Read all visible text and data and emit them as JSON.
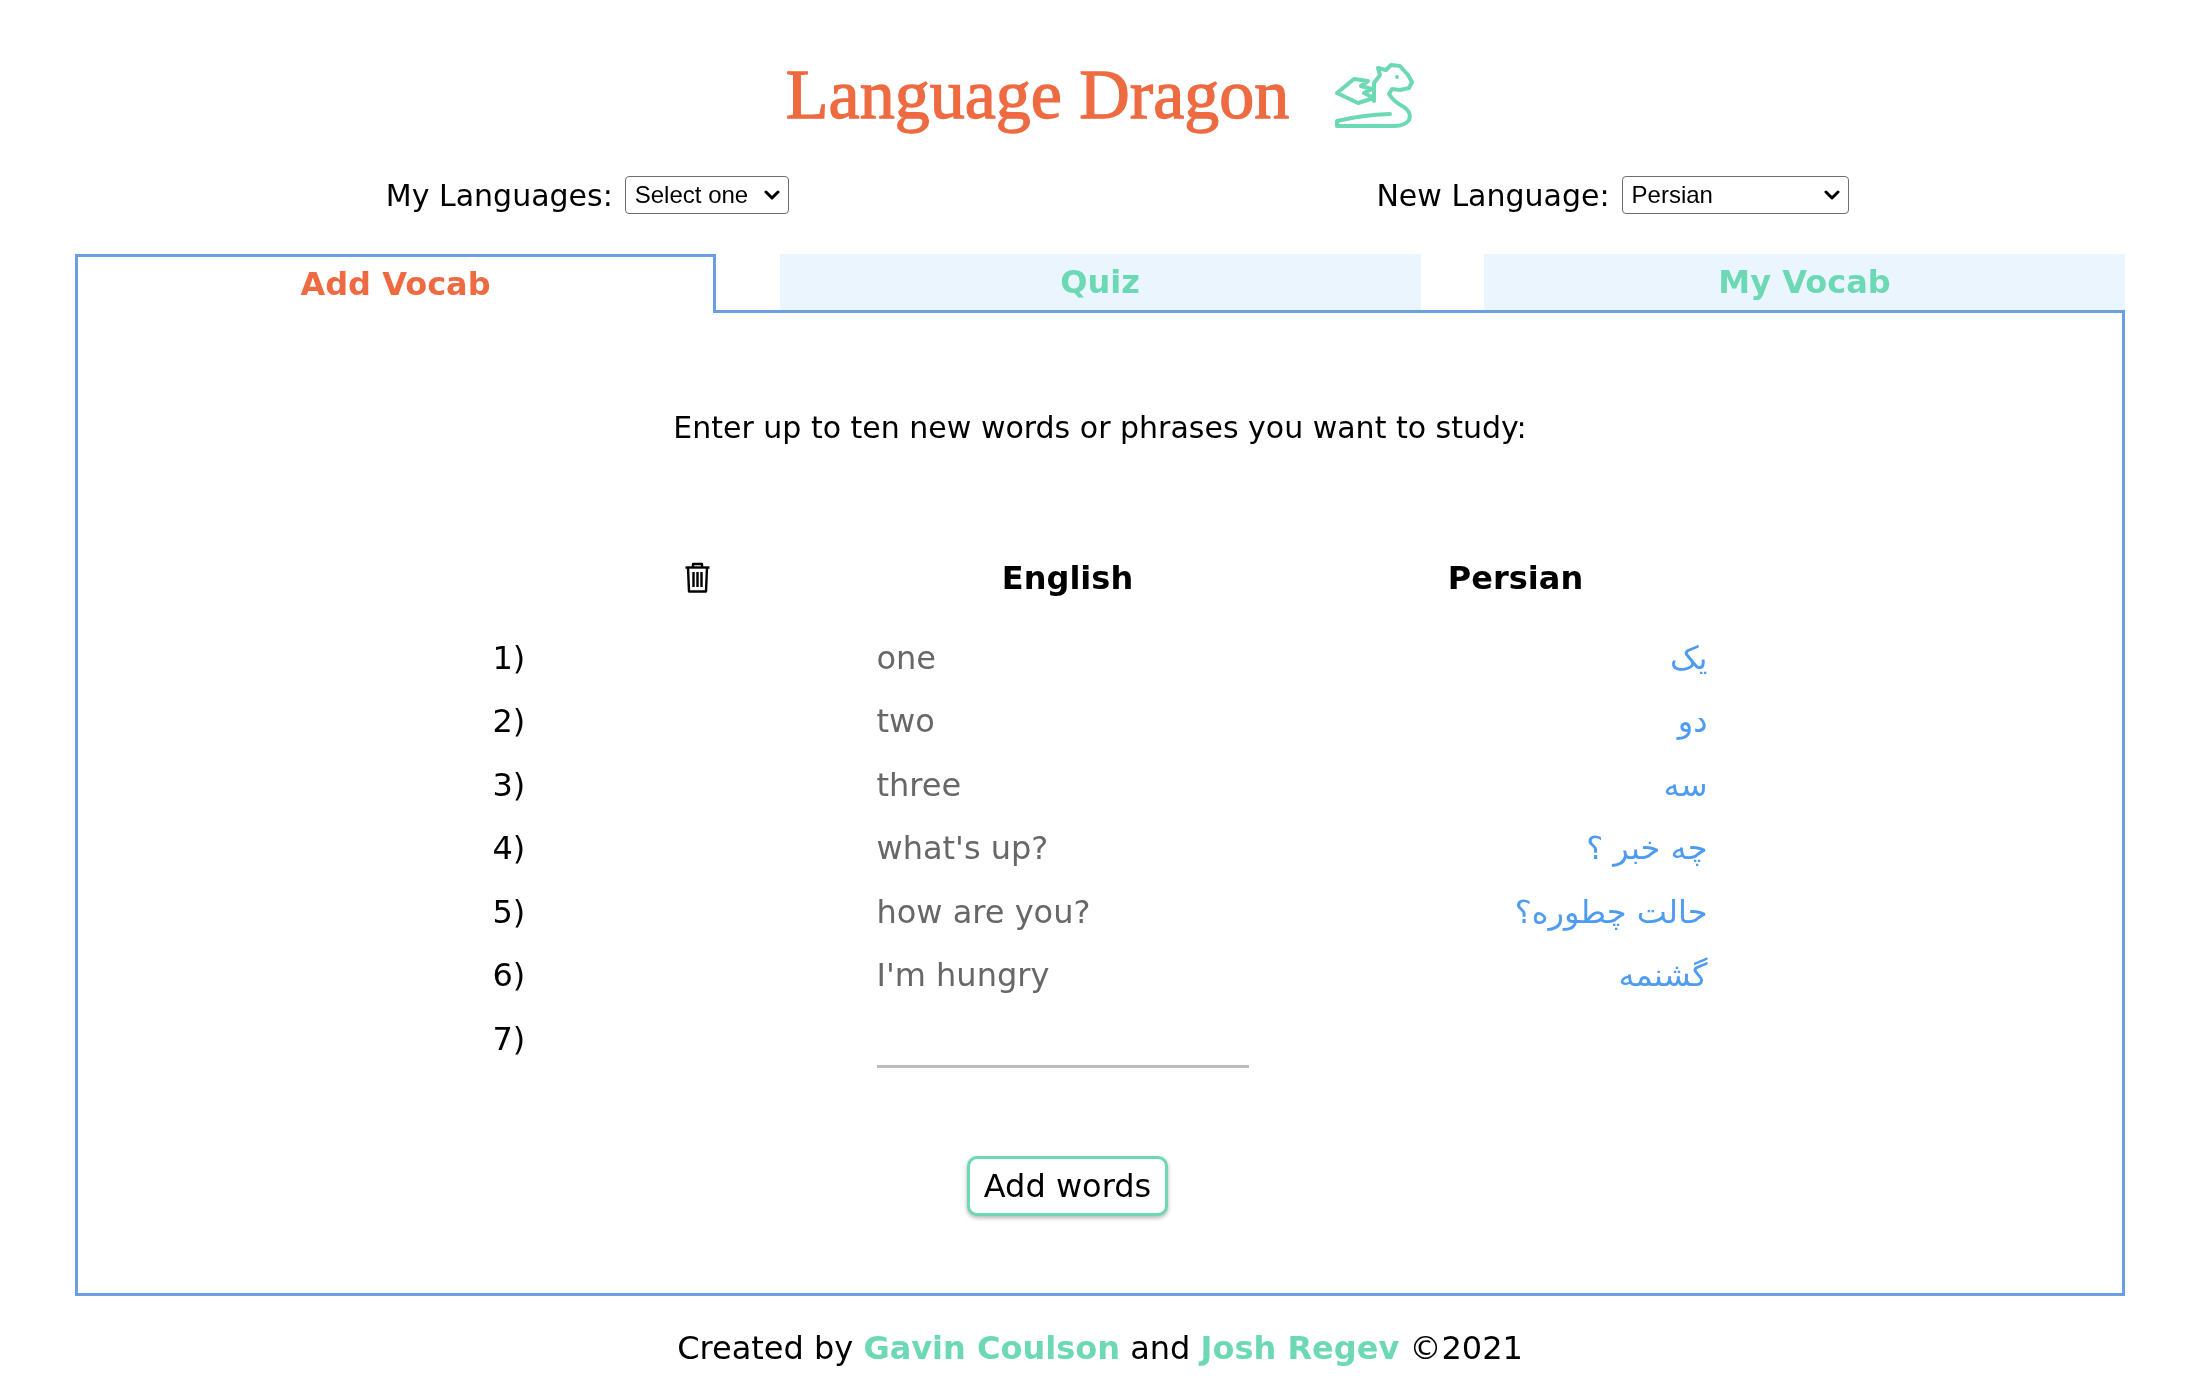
{
  "header": {
    "title": "Language Dragon"
  },
  "language_selects": [
    {
      "label": "My Languages:",
      "value": "Select one"
    },
    {
      "label": "New Language:",
      "value": "Persian"
    }
  ],
  "tabs": [
    {
      "label": "Add Vocab",
      "selected": true
    },
    {
      "label": "Quiz",
      "selected": false
    },
    {
      "label": "My Vocab",
      "selected": false
    }
  ],
  "add_vocab": {
    "instruction": "Enter up to ten new words or phrases you want to study:",
    "columns": [
      "English",
      "Persian"
    ],
    "rows": [
      {
        "number": "1)",
        "kind": "entry",
        "english": "one",
        "persian": "یک"
      },
      {
        "number": "2)",
        "kind": "entry",
        "english": "two",
        "persian": "دو"
      },
      {
        "number": "3)",
        "kind": "entry",
        "english": "three",
        "persian": "سه"
      },
      {
        "number": "4)",
        "kind": "entry",
        "english": "what's up?",
        "persian": "چه خبر ؟"
      },
      {
        "number": "5)",
        "kind": "entry",
        "english": "how are you?",
        "persian": "حالت چطوره؟"
      },
      {
        "number": "6)",
        "kind": "entry",
        "english": "I'm hungry",
        "persian": "گشنمه"
      },
      {
        "number": "7)",
        "kind": "input"
      }
    ],
    "button": "Add words"
  },
  "footer": {
    "segments": [
      {
        "kind": "text",
        "text": "Created by"
      },
      {
        "kind": "link",
        "text": "Gavin Coulson"
      },
      {
        "kind": "text",
        "text": "and"
      },
      {
        "kind": "link",
        "text": "Josh Regev"
      },
      {
        "kind": "text",
        "text": "©2021"
      }
    ]
  }
}
